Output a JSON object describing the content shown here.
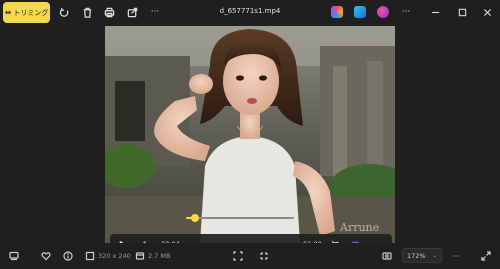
{
  "titlebar": {
    "trim_label": "トリミング",
    "filename": "d_657771s1.mp4",
    "icons": [
      "trim-icon",
      "rotate-icon",
      "delete-icon",
      "print-icon",
      "share-icon",
      "more-icon",
      "copilot-icon",
      "clipchamp-icon",
      "designer-icon",
      "more-options-icon",
      "minimize-icon",
      "maximize-icon",
      "close-icon"
    ]
  },
  "image": {
    "watermark": "Arrune"
  },
  "player": {
    "current_time": "00:04",
    "duration": "01:00",
    "progress_fraction": 0.08,
    "accent_color": "#f5d94a"
  },
  "bottombar": {
    "dimensions": "320 x 240",
    "file_size": "2.7 MB",
    "zoom": "172%",
    "icons": [
      "filmstrip-icon",
      "favorite-icon",
      "info-icon",
      "resolution-icon",
      "storage-icon",
      "fit-icon",
      "fullscreen-icon",
      "zoom-dropdown-icon",
      "more-icon",
      "expand-icon"
    ]
  }
}
